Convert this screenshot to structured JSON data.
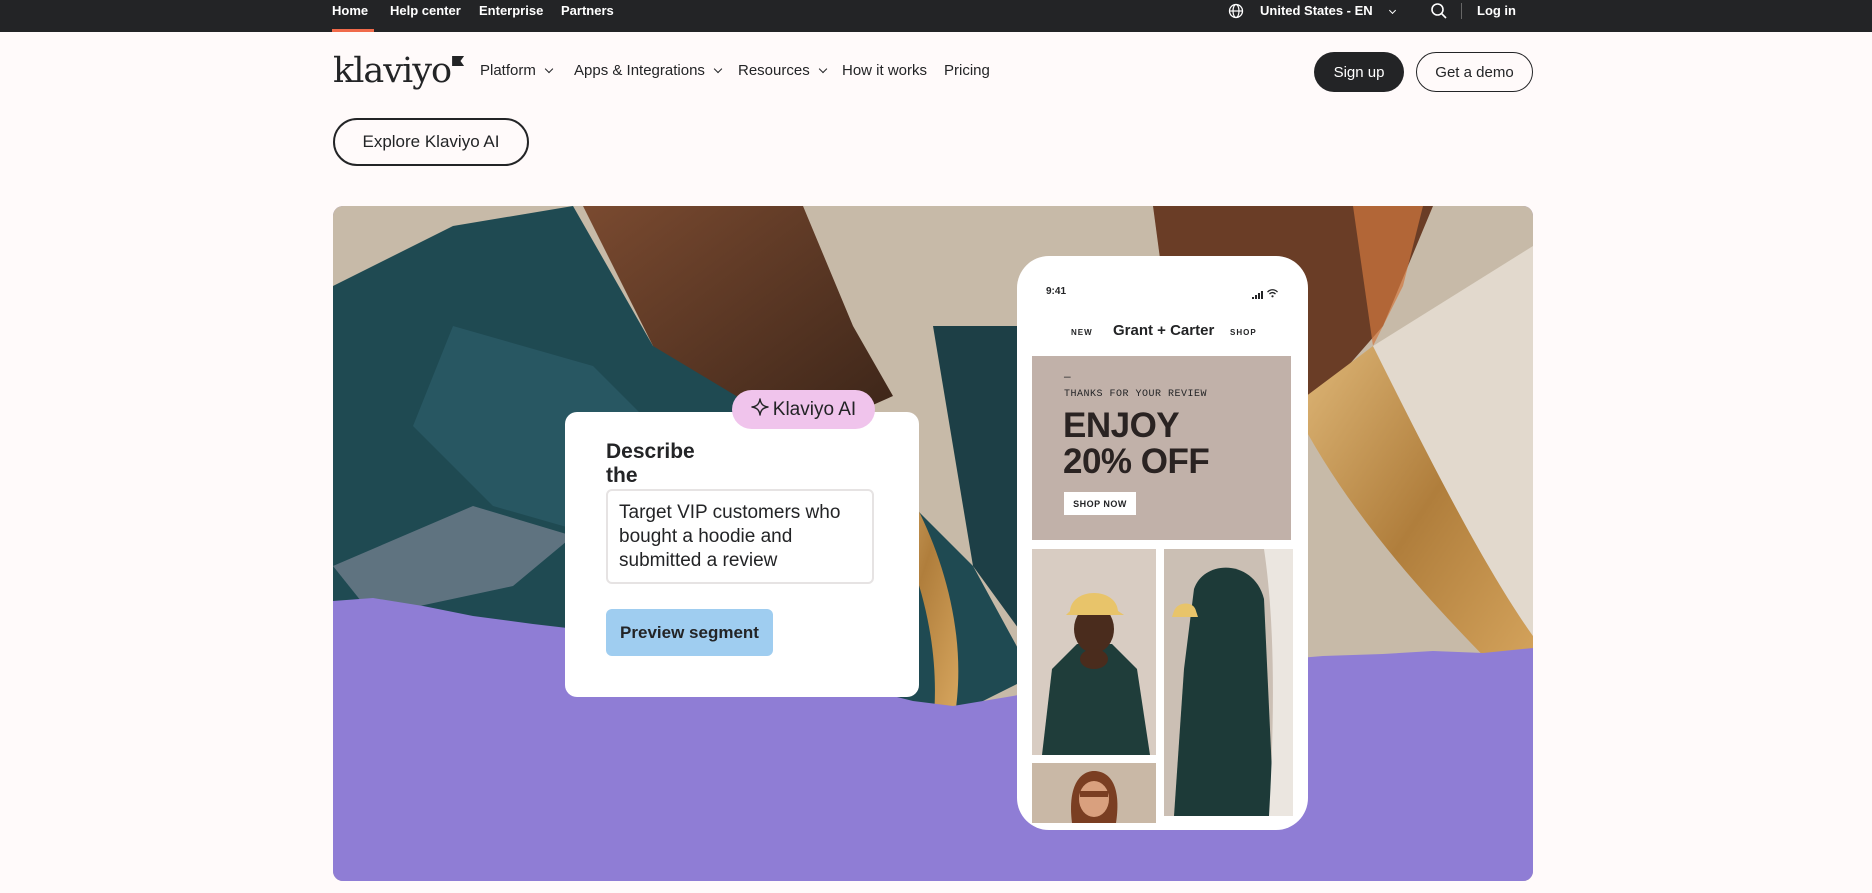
{
  "topbar": {
    "links": [
      "Home",
      "Help center",
      "Enterprise",
      "Partners"
    ],
    "region": "United States - EN",
    "login": "Log in"
  },
  "nav": {
    "logo": "klaviyo",
    "items": [
      "Platform",
      "Apps & Integrations",
      "Resources",
      "How it works",
      "Pricing"
    ],
    "signup": "Sign up",
    "demo": "Get a demo"
  },
  "explore_button": "Explore Klaviyo AI",
  "segment_card": {
    "pill": "Klaviyo AI",
    "title": "Describe the segment",
    "prompt": "Target VIP customers who bought a hoodie and submitted a review",
    "preview_button": "Preview segment"
  },
  "phone": {
    "time": "9:41",
    "nav_new": "NEW",
    "brand": "Grant + Carter",
    "nav_shop": "SHOP",
    "promo": {
      "dash": "—",
      "thanks": "THANKS FOR YOUR REVIEW",
      "headline_line1": "ENJOY",
      "headline_line2": "20% OFF",
      "cta": "SHOP NOW"
    }
  },
  "colors": {
    "dark": "#232426",
    "accent_underline": "#f06a4a",
    "hero_purple": "#8f7dd5",
    "pill_pink": "#f0c4ec",
    "preview_blue": "#9fcdf0",
    "promo_tan": "#c1b1a9"
  },
  "icons": [
    "globe-icon",
    "chevron-down-icon",
    "search-icon",
    "sparkle-icon",
    "signal-icon",
    "wifi-icon"
  ]
}
